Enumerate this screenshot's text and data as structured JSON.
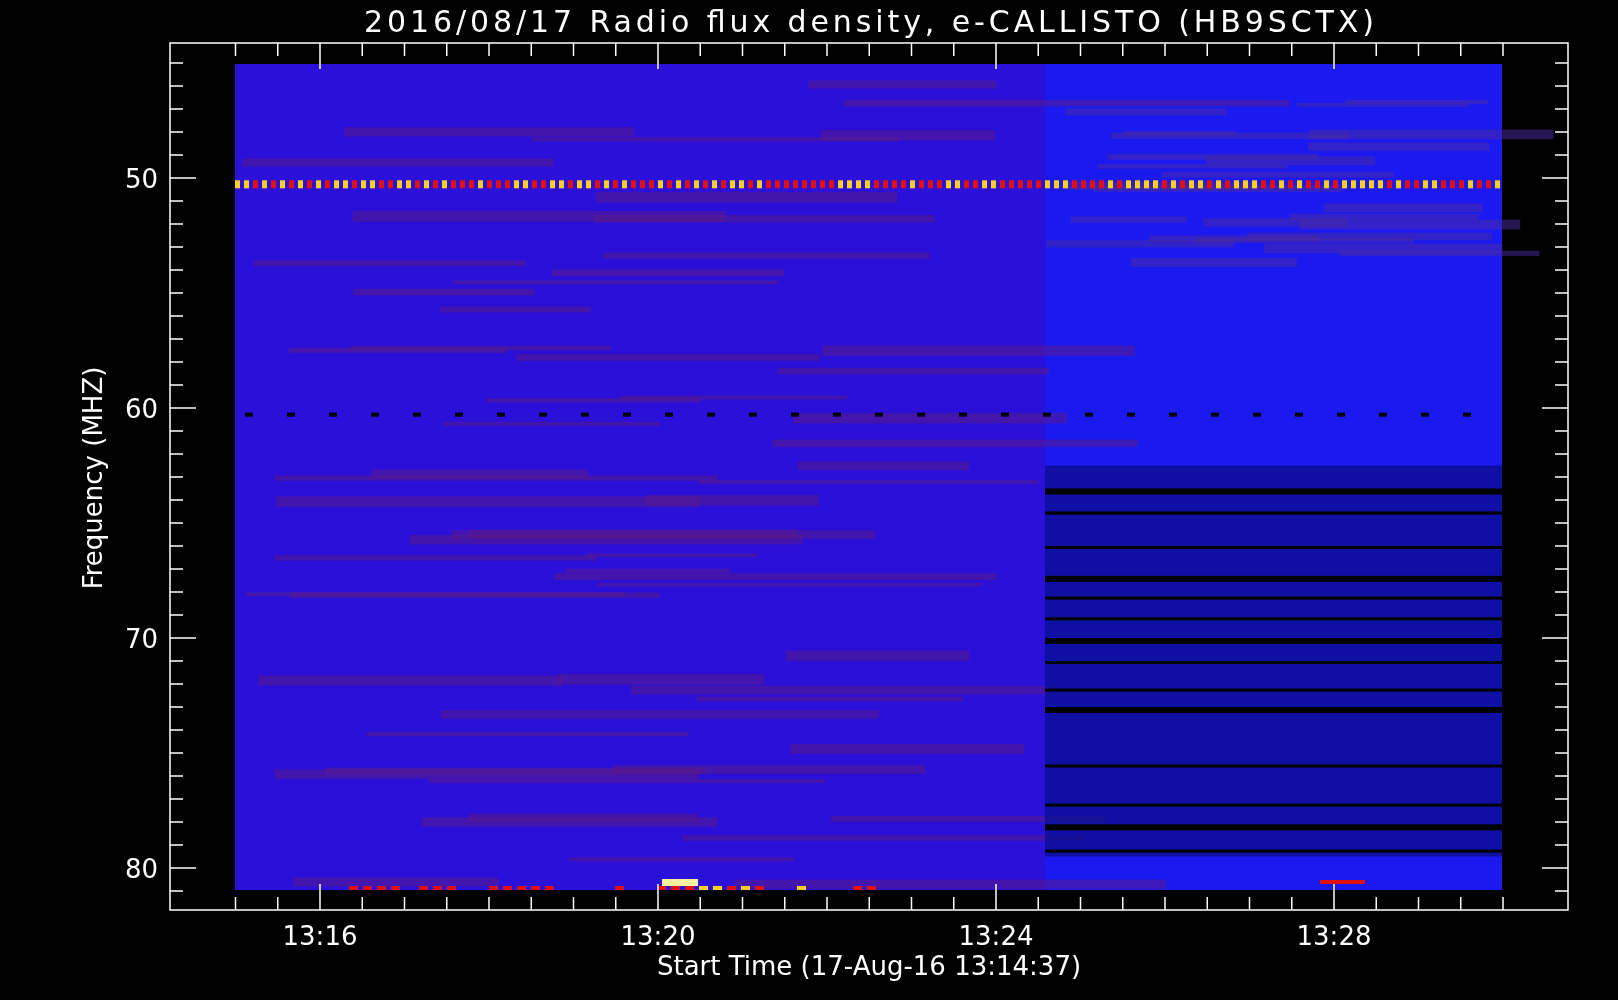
{
  "title": "2016/08/17  Radio flux density, e-CALLISTO (HB9SCTX)",
  "y_axis": {
    "label": "Frequency (MHZ)",
    "ticks": [
      "50",
      "60",
      "70",
      "80"
    ]
  },
  "x_axis": {
    "label": "Start Time (17-Aug-16 13:14:37)",
    "ticks": [
      "13:16",
      "13:20",
      "13:24",
      "13:28"
    ]
  }
}
